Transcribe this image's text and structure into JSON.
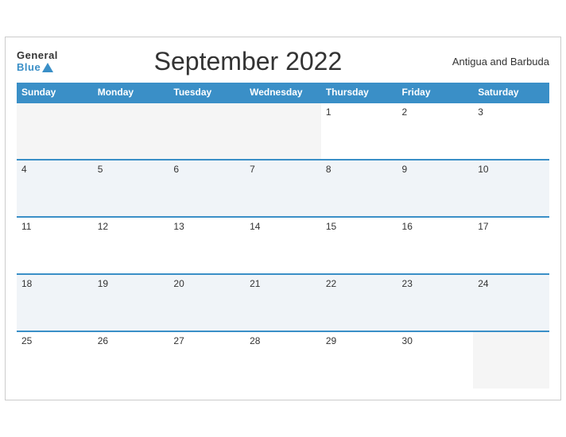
{
  "header": {
    "logo_general": "General",
    "logo_blue": "Blue",
    "title": "September 2022",
    "country": "Antigua and Barbuda"
  },
  "weekdays": [
    "Sunday",
    "Monday",
    "Tuesday",
    "Wednesday",
    "Thursday",
    "Friday",
    "Saturday"
  ],
  "weeks": [
    [
      {
        "day": "",
        "empty": true
      },
      {
        "day": "",
        "empty": true
      },
      {
        "day": "",
        "empty": true
      },
      {
        "day": "",
        "empty": true
      },
      {
        "day": "1",
        "empty": false
      },
      {
        "day": "2",
        "empty": false
      },
      {
        "day": "3",
        "empty": false
      }
    ],
    [
      {
        "day": "4",
        "empty": false
      },
      {
        "day": "5",
        "empty": false
      },
      {
        "day": "6",
        "empty": false
      },
      {
        "day": "7",
        "empty": false
      },
      {
        "day": "8",
        "empty": false
      },
      {
        "day": "9",
        "empty": false
      },
      {
        "day": "10",
        "empty": false
      }
    ],
    [
      {
        "day": "11",
        "empty": false
      },
      {
        "day": "12",
        "empty": false
      },
      {
        "day": "13",
        "empty": false
      },
      {
        "day": "14",
        "empty": false
      },
      {
        "day": "15",
        "empty": false
      },
      {
        "day": "16",
        "empty": false
      },
      {
        "day": "17",
        "empty": false
      }
    ],
    [
      {
        "day": "18",
        "empty": false
      },
      {
        "day": "19",
        "empty": false
      },
      {
        "day": "20",
        "empty": false
      },
      {
        "day": "21",
        "empty": false
      },
      {
        "day": "22",
        "empty": false
      },
      {
        "day": "23",
        "empty": false
      },
      {
        "day": "24",
        "empty": false
      }
    ],
    [
      {
        "day": "25",
        "empty": false
      },
      {
        "day": "26",
        "empty": false
      },
      {
        "day": "27",
        "empty": false
      },
      {
        "day": "28",
        "empty": false
      },
      {
        "day": "29",
        "empty": false
      },
      {
        "day": "30",
        "empty": false
      },
      {
        "day": "",
        "empty": true
      }
    ]
  ]
}
